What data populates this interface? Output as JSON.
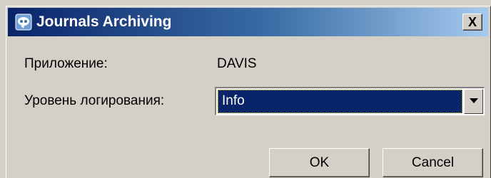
{
  "window": {
    "title": "Journals Archiving",
    "close_label": "X",
    "title_icon": "app-icon"
  },
  "form": {
    "application_label": "Приложение:",
    "application_value": "DAVIS",
    "log_level_label": "Уровень логирования:",
    "log_level_value": "Info"
  },
  "buttons": {
    "ok_label": "OK",
    "cancel_label": "Cancel"
  },
  "colors": {
    "title_gradient_start": "#0a246a",
    "title_gradient_end": "#a6caf0",
    "selection_bg": "#0a246a",
    "dialog_bg": "#d4d0c8"
  }
}
